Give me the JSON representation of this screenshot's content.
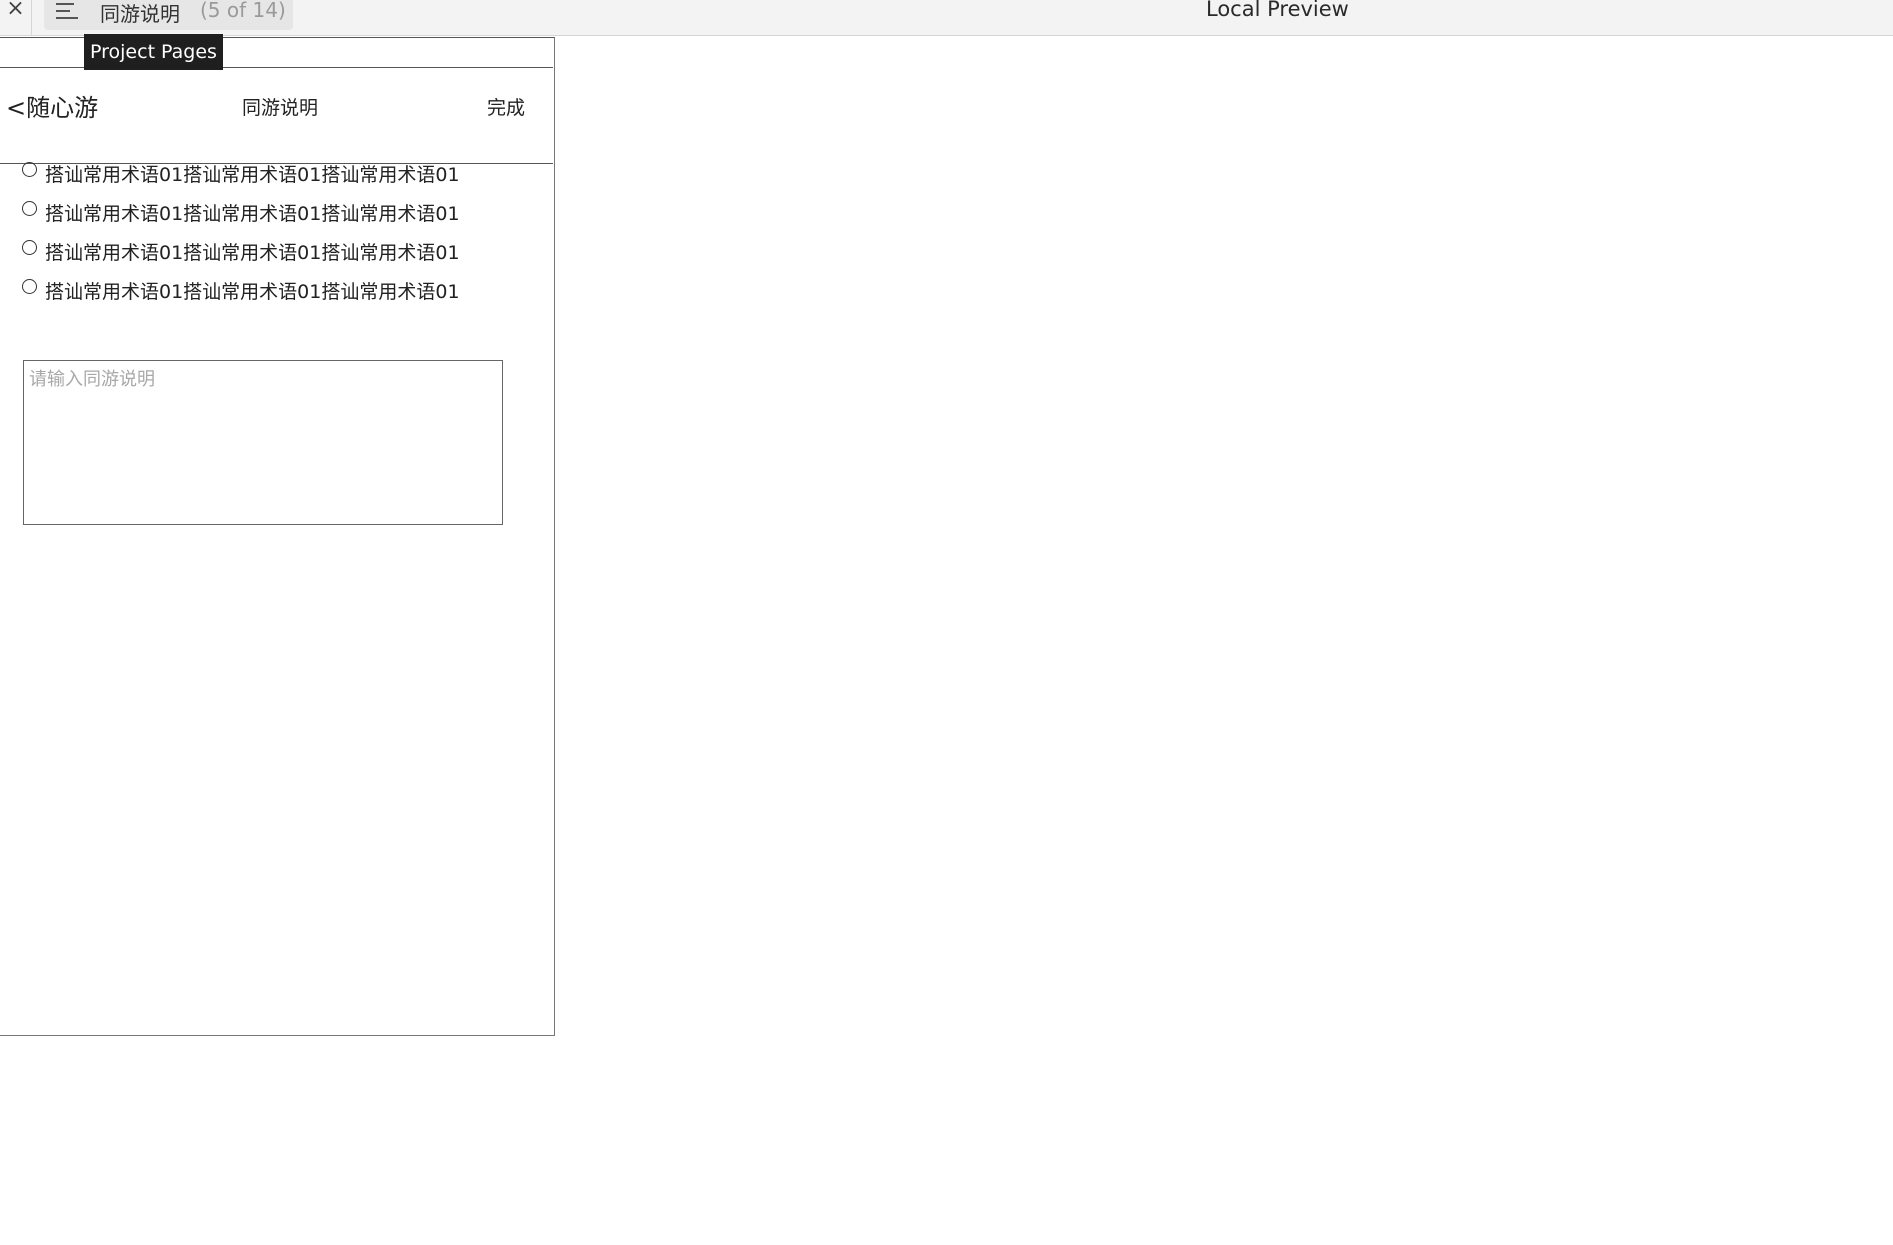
{
  "app": {
    "close_symbol": "×",
    "pages": {
      "current_page": "同游说明",
      "count_label": "(5 of 14)",
      "menu_icon": "menu-icon"
    },
    "tooltip": "Project Pages",
    "preview_title": "Local Preview"
  },
  "screen": {
    "navbar": {
      "back_label": "<随心游",
      "title": "同游说明",
      "done_label": "完成"
    },
    "options": [
      {
        "label": "搭讪常用术语01搭讪常用术语01搭讪常用术语01"
      },
      {
        "label": "搭讪常用术语01搭讪常用术语01搭讪常用术语01"
      },
      {
        "label": "搭讪常用术语01搭讪常用术语01搭讪常用术语01"
      },
      {
        "label": "搭讪常用术语01搭讪常用术语01搭讪常用术语01"
      }
    ],
    "description": {
      "value": "",
      "placeholder": "请输入同游说明"
    }
  }
}
